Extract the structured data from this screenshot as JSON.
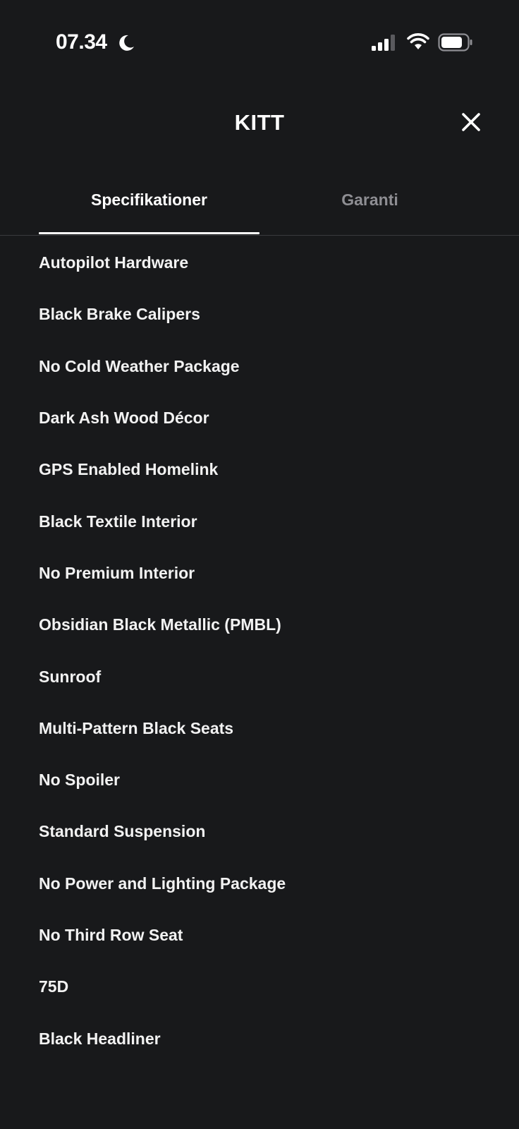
{
  "status_bar": {
    "time": "07.34",
    "icons": [
      "moon-icon",
      "cellular-signal-icon",
      "wifi-icon",
      "battery-icon"
    ]
  },
  "header": {
    "title": "KITT",
    "close_icon": "close-icon"
  },
  "tabs": [
    {
      "label": "Specifikationer",
      "active": true
    },
    {
      "label": "Garanti",
      "active": false
    }
  ],
  "specifications": [
    "Autopilot Hardware",
    "Black Brake Calipers",
    "No Cold Weather Package",
    "Dark Ash Wood Décor",
    "GPS Enabled Homelink",
    "Black Textile Interior",
    "No Premium Interior",
    "Obsidian Black Metallic (PMBL)",
    "Sunroof",
    "Multi-Pattern Black Seats",
    "No Spoiler",
    "Standard Suspension",
    "No Power and Lighting Package",
    "No Third Row Seat",
    "75D",
    "Black Headliner"
  ],
  "colors": {
    "background": "#18191b",
    "text_primary": "#ffffff",
    "text_inactive_tab": "#8e8e93",
    "divider": "#3a3b3e"
  }
}
